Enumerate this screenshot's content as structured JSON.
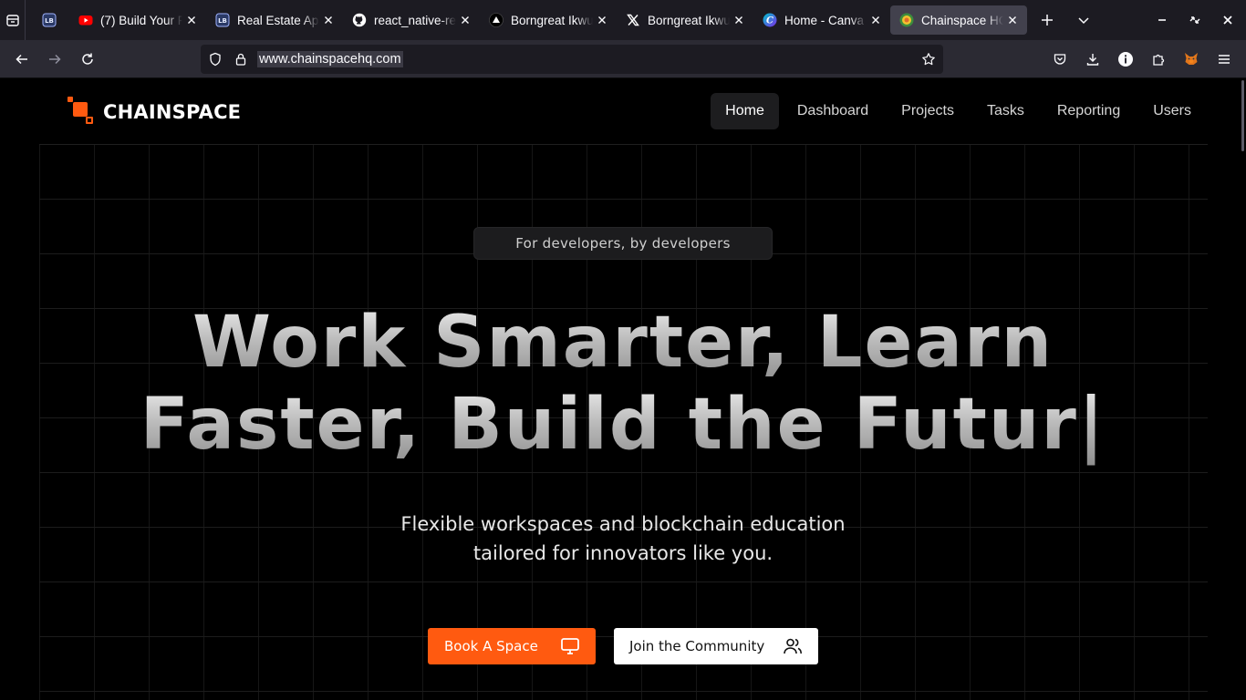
{
  "browser": {
    "tabs": [
      {
        "title": "",
        "favicon": "lb-icon",
        "fav_color": "#3b5bdb",
        "pinned": true
      },
      {
        "title": "(7) Build Your F",
        "favicon": "youtube-icon",
        "fav_color": "#ff0000"
      },
      {
        "title": "Real Estate App",
        "favicon": "lb-icon",
        "fav_color": "#3b5bdb"
      },
      {
        "title": "react_native-re",
        "favicon": "github-icon",
        "fav_color": "#ffffff"
      },
      {
        "title": "Borngreat Ikwu",
        "favicon": "vercel-icon",
        "fav_color": "#ffffff"
      },
      {
        "title": "Borngreat Ikwu",
        "favicon": "x-icon",
        "fav_color": "#ffffff"
      },
      {
        "title": "Home - Canva",
        "favicon": "canva-icon",
        "fav_color": "#7d2ae8"
      },
      {
        "title": "Chainspace HQ",
        "favicon": "chainspace-icon",
        "fav_color": "#ff5a10",
        "active": true
      }
    ],
    "url": "www.chainspacehq.com"
  },
  "site": {
    "brand": "CHAINSPACE",
    "nav": [
      "Home",
      "Dashboard",
      "Projects",
      "Tasks",
      "Reporting",
      "Users"
    ],
    "nav_active": "Home",
    "pill": "For developers, by developers",
    "hero_line1": "Work Smarter, Learn",
    "hero_line2": "Faster, Build the Futur|",
    "subtitle_line1": "Flexible workspaces and blockchain education",
    "subtitle_line2": "tailored for innovators like you.",
    "cta_primary": "Book A Space",
    "cta_secondary": "Join the Community"
  },
  "colors": {
    "accent": "#ff5a10",
    "page_bg": "#000000",
    "chrome_bg": "#1c1b22"
  }
}
